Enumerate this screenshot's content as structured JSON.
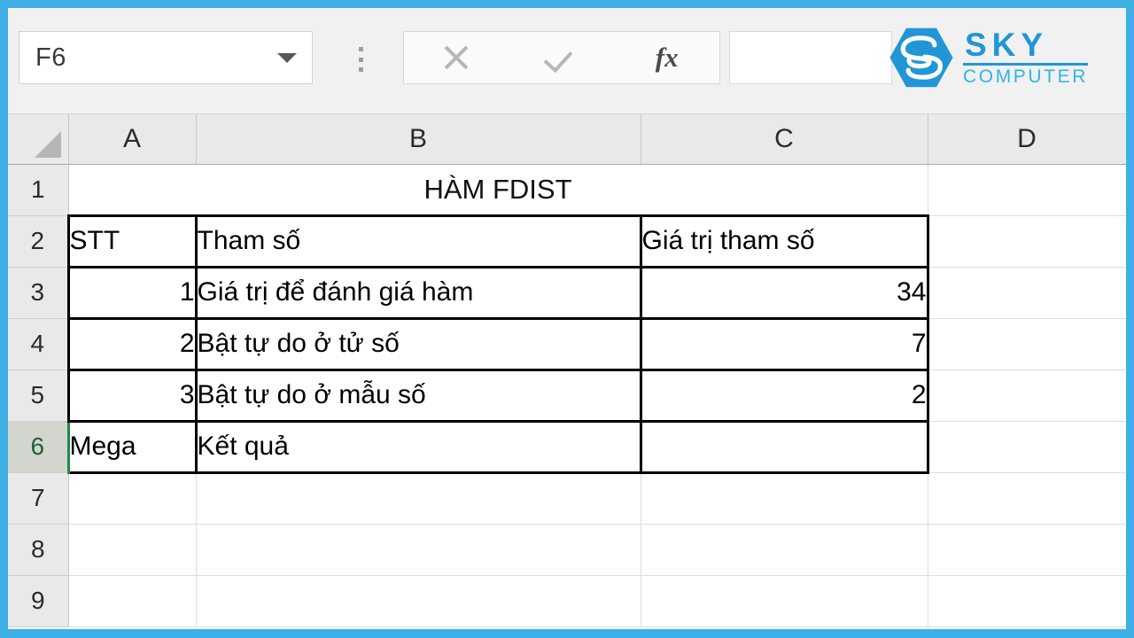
{
  "window": {
    "border_color": "#3fb0e5",
    "accent_green": "#1f8a4c"
  },
  "formula_bar": {
    "name_box_value": "F6",
    "name_box_dropdown_icon": "chevron-down-icon",
    "resize_handle_icon": "vertical-dots-icon",
    "cancel_icon": "close-x-icon",
    "enter_icon": "checkmark-icon",
    "insert_function_icon": "fx-icon",
    "insert_function_label": "fx",
    "formula_value": "",
    "formula_placeholder": ""
  },
  "logo": {
    "mark_icon": "sky-hexagon-s-icon",
    "primary": "SKY",
    "secondary": "COMPUTER",
    "color_primary": "#2196d6",
    "color_secondary": "#30b4e8"
  },
  "sheet": {
    "select_all_icon": "select-all-triangle-icon",
    "columns": [
      "A",
      "B",
      "C",
      "D"
    ],
    "rows": [
      "1",
      "2",
      "3",
      "4",
      "5",
      "6",
      "7",
      "8",
      "9"
    ],
    "active_cell": "F6",
    "active_row": "6",
    "title": "HÀM FDIST",
    "table": {
      "headers": [
        "STT",
        "Tham số",
        "Giá trị tham số"
      ],
      "rows": [
        {
          "stt": "1",
          "param": "Giá trị để đánh giá hàm",
          "value": "34"
        },
        {
          "stt": "2",
          "param": "Bật tự do ở tử số",
          "value": "7"
        },
        {
          "stt": "3",
          "param": "Bật tự do ở mẫu số",
          "value": "2"
        },
        {
          "stt": "Mega",
          "param": "Kết quả",
          "value": ""
        }
      ]
    }
  }
}
